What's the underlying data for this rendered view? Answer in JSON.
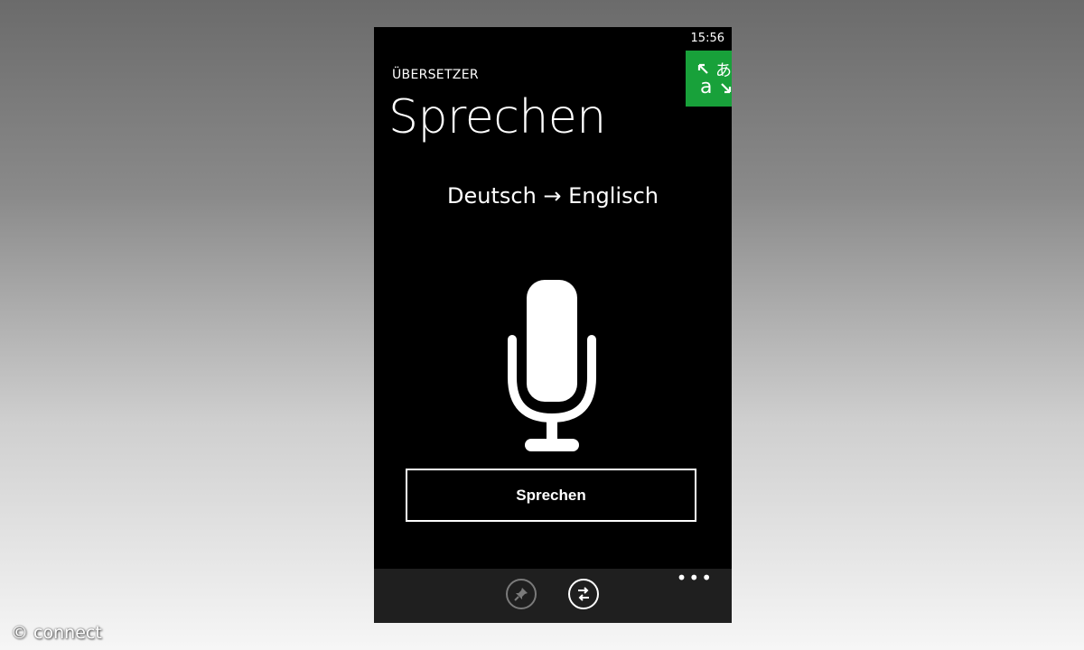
{
  "status": {
    "time": "15:56"
  },
  "header": {
    "app_name": "ÜBERSETZER",
    "title": "Sprechen"
  },
  "app_tile": {
    "icon": "translator-icon",
    "color": "#18a13a",
    "glyph_top": "あ",
    "glyph_bottom": "a"
  },
  "language": {
    "pair": "Deutsch → Englisch"
  },
  "speak": {
    "button_label": "Sprechen",
    "icon": "microphone-icon"
  },
  "app_bar": {
    "buttons": [
      {
        "icon": "pin-icon",
        "enabled": false
      },
      {
        "icon": "swap-languages-icon",
        "enabled": true
      }
    ],
    "more": "•••"
  },
  "watermark": {
    "text": "© connect"
  }
}
